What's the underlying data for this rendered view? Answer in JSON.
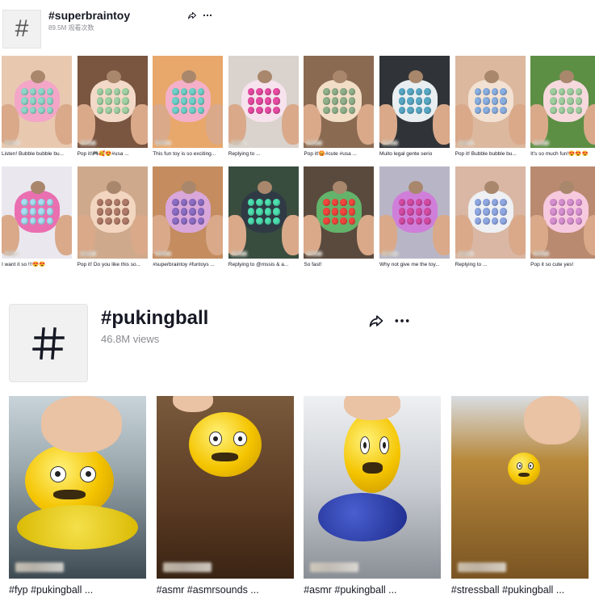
{
  "top": {
    "hashtag_glyph": "#",
    "title": "#superbraintoy",
    "views": "89.5M 观看次数",
    "share_icon": "share-arrow-icon",
    "more_icon": "more-dots-icon",
    "row1": [
      {
        "caption": "Listen! Bubble bubble bu...",
        "bg": "#e8c9b0",
        "toy": "#f3a6c7",
        "bub": "#8fd6c9"
      },
      {
        "caption": "Pop it!🎮🥰😍#usa ...",
        "bg": "#7a5540",
        "toy": "#f3d9c7",
        "bub": "#a0d1a3"
      },
      {
        "caption": "This fun toy is so exciting...",
        "bg": "#e8a86b",
        "toy": "#f4b0c8",
        "bub": "#6ed0c8"
      },
      {
        "caption": "Replying to ...",
        "bg": "#dad2cc",
        "toy": "#f6e3ee",
        "bub": "#e74aa2"
      },
      {
        "caption": "Pop it!😡#cute #usa ...",
        "bg": "#8b6a52",
        "toy": "#f2ddc6",
        "bub": "#8fb08a"
      },
      {
        "caption": "Muito legal gente serio",
        "bg": "#303438",
        "toy": "#e9eef0",
        "bub": "#58a7c4"
      },
      {
        "caption": "Pop it! Bubble bubble bu...",
        "bg": "#dcb89e",
        "toy": "#f3e2d3",
        "bub": "#89aee0"
      },
      {
        "caption": "It's so much fun!😍😍😍",
        "bg": "#5c8f44",
        "toy": "#f6d9dd",
        "bub": "#9fcfa0"
      }
    ],
    "row2": [
      {
        "caption": "I want it so !!!😍😍",
        "bg": "#eae7ef",
        "toy": "#ea6fb1",
        "bub": "#a7dff2"
      },
      {
        "caption": "Pop it! Do you like this so...",
        "bg": "#cfa98c",
        "toy": "#f2d6c0",
        "bub": "#b07a68"
      },
      {
        "caption": "#superbraintoy #funtoys ...",
        "bg": "#c48c5f",
        "toy": "#d9a7d9",
        "bub": "#8c6cc4"
      },
      {
        "caption": "Replying to @mssis & a...",
        "bg": "#394d3f",
        "toy": "#2f3a45",
        "bub": "#4ee0b0"
      },
      {
        "caption": "So fast!",
        "bg": "#5a4a3e",
        "toy": "#64b36a",
        "bub": "#f1453d"
      },
      {
        "caption": "Why not give me the toy...",
        "bg": "#b8b6c6",
        "toy": "#cf7fd9",
        "bub": "#d34aa3"
      },
      {
        "caption": "Replying to ...",
        "bg": "#d9b7a4",
        "toy": "#eef0f3",
        "bub": "#8fa7e2"
      },
      {
        "caption": "Pop it so cute yes!",
        "bg": "#b98a70",
        "toy": "#f7c9de",
        "bub": "#d68fd0"
      }
    ]
  },
  "bottom": {
    "hashtag_glyph": "#",
    "title": "#pukingball",
    "views": "46.8M views",
    "share_icon": "share-arrow-icon",
    "more_icon": "more-dots-icon",
    "videos": [
      {
        "caption": "#fyp #pukingball ...",
        "bg": "#8a9aa3"
      },
      {
        "caption": "#asmr #asmrsounds ...",
        "bg": "#6b4a2e"
      },
      {
        "caption": "#asmr #pukingball ...",
        "bg": "#9aa3b0"
      },
      {
        "caption": "#stressball #pukingball ...",
        "bg": "#8a6a3a"
      }
    ]
  }
}
